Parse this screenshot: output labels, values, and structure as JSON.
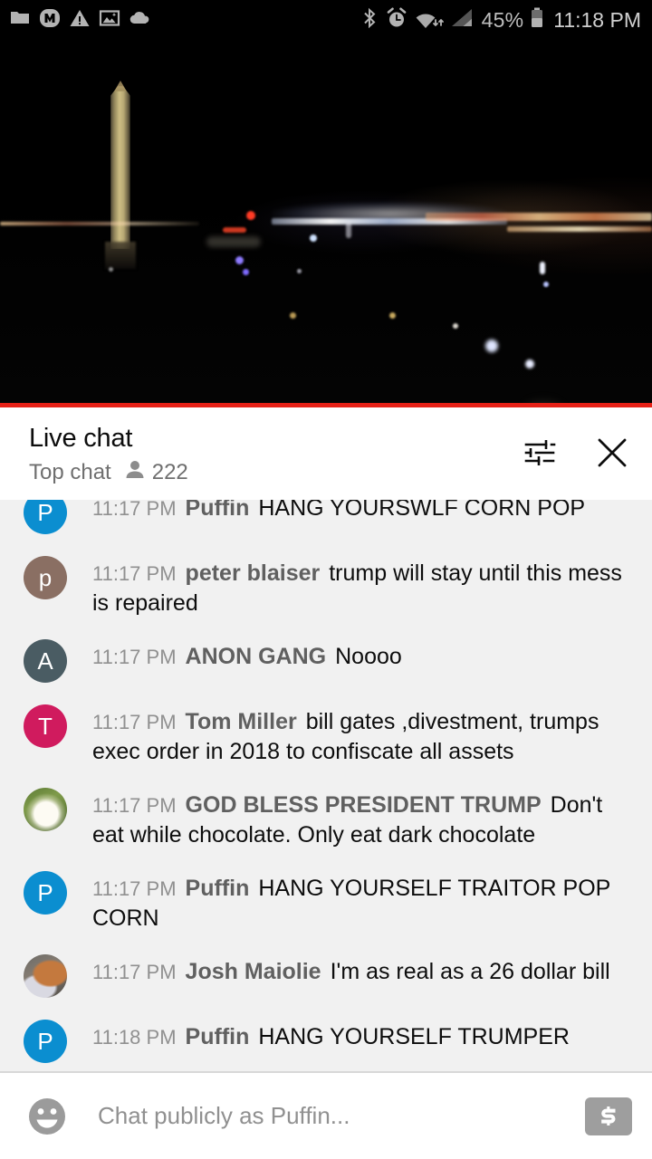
{
  "status_bar": {
    "left_icons": [
      "folder-icon",
      "m-app-icon",
      "warning-icon",
      "image-icon",
      "cloud-icon"
    ],
    "right_icons": [
      "bluetooth-icon",
      "alarm-icon",
      "wifi-icon",
      "signal-icon"
    ],
    "battery_percent": "45%",
    "battery_icon": "battery-icon",
    "time": "11:18 PM"
  },
  "player": {
    "scene_description": "Washington Monument at night",
    "progress_percent": 100,
    "progress_color": "#e62117"
  },
  "chat_header": {
    "title": "Live chat",
    "mode": "Top chat",
    "viewers_icon": "person-icon",
    "viewers": "222",
    "settings_icon": "tune-sliders-icon",
    "close_icon": "close-icon"
  },
  "messages": [
    {
      "time": "11:17 PM",
      "author": "Puffin",
      "text": "HANG YOURSWLF CORN POP",
      "avatar": {
        "type": "letter",
        "letter": "P",
        "color": "#0b8ed0"
      },
      "clipped": true
    },
    {
      "time": "11:17 PM",
      "author": "peter blaiser",
      "text": "trump will stay until this mess is repaired",
      "avatar": {
        "type": "letter",
        "letter": "p",
        "color": "#8a6f63"
      },
      "clipped": false
    },
    {
      "time": "11:17 PM",
      "author": "ANON GANG",
      "text": "Noooo",
      "avatar": {
        "type": "letter",
        "letter": "A",
        "color": "#4a5c63"
      },
      "clipped": false
    },
    {
      "time": "11:17 PM",
      "author": "Tom Miller",
      "text": "bill gates ,divestment, trumps exec order in 2018 to confiscate all assets",
      "avatar": {
        "type": "letter",
        "letter": "T",
        "color": "#d01b5e"
      },
      "clipped": false
    },
    {
      "time": "11:17 PM",
      "author": "GOD BLESS PRESIDENT TRUMP",
      "text": "Don't eat while chocolate. Only eat dark chocolate",
      "avatar": {
        "type": "photo",
        "photo": "puppy-photo",
        "letter": "",
        "color": "#6d8b3f"
      },
      "clipped": false
    },
    {
      "time": "11:17 PM",
      "author": "Puffin",
      "text": "HANG YOURSELF TRAITOR POP CORN",
      "avatar": {
        "type": "letter",
        "letter": "P",
        "color": "#0b8ed0"
      },
      "clipped": false
    },
    {
      "time": "11:17 PM",
      "author": "Josh Maiolie",
      "text": "I'm as real as a 26 dollar bill",
      "avatar": {
        "type": "photo",
        "photo": "dog-photo",
        "letter": "",
        "color": "#8a7f74"
      },
      "clipped": false
    },
    {
      "time": "11:18 PM",
      "author": "Puffin",
      "text": "HANG YOURSELF TRUMPER",
      "avatar": {
        "type": "letter",
        "letter": "P",
        "color": "#0b8ed0"
      },
      "clipped": false
    }
  ],
  "input_bar": {
    "emoji_icon": "emoji-smiley-icon",
    "placeholder": "Chat publicly as Puffin...",
    "value": "",
    "superchat_icon": "dollar-superchat-icon"
  }
}
